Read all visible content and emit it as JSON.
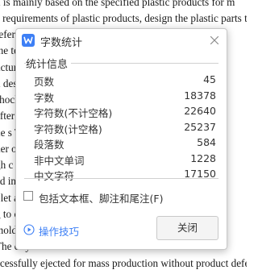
{
  "document": {
    "lines": [
      "n is mainly based on the specified plastic products for m",
      "e requirements of plastic products, design the plastic parts that m",
      "refer                                                          ic mo",
      "the                                                            techn",
      "ucture                                                         for i",
      "n des",
      "shock                                                          is fi",
      "after                                                          ity i",
      "ne s                                                           The",
      "der o                                                          ut sc",
      "gh c                                                           ty m",
      "ed in                                                          are s",
      "plet                                                           and c",
      "g to                                                           onsid",
      "mold                                                           ts me",
      "The c                                                          ry dr",
      "ccessfully ejected for mass production without product defects. I"
    ]
  },
  "dialog": {
    "title": "字数统计",
    "section_title": "统计信息",
    "stats": [
      {
        "label": "页数",
        "value": "45"
      },
      {
        "label": "字数",
        "value": "18378"
      },
      {
        "label": "字符数(不计空格)",
        "value": "22640"
      },
      {
        "label": "字符数(计空格)",
        "value": "25237"
      },
      {
        "label": "段落数",
        "value": "584"
      },
      {
        "label": "非中文单词",
        "value": "1228"
      },
      {
        "label": "中文字符",
        "value": "17150"
      }
    ],
    "include_checkbox_label": "包括文本框、脚注和尾注(F)",
    "include_checked": false,
    "tips_label": "操作技巧",
    "close_button_label": "关闭"
  },
  "colors": {
    "accent": "#3d7ff5",
    "app_icon": "#3d7ff5"
  },
  "icons": {
    "app": "wps-writer-icon",
    "close": "close-icon",
    "tips": "play-circle-icon"
  }
}
